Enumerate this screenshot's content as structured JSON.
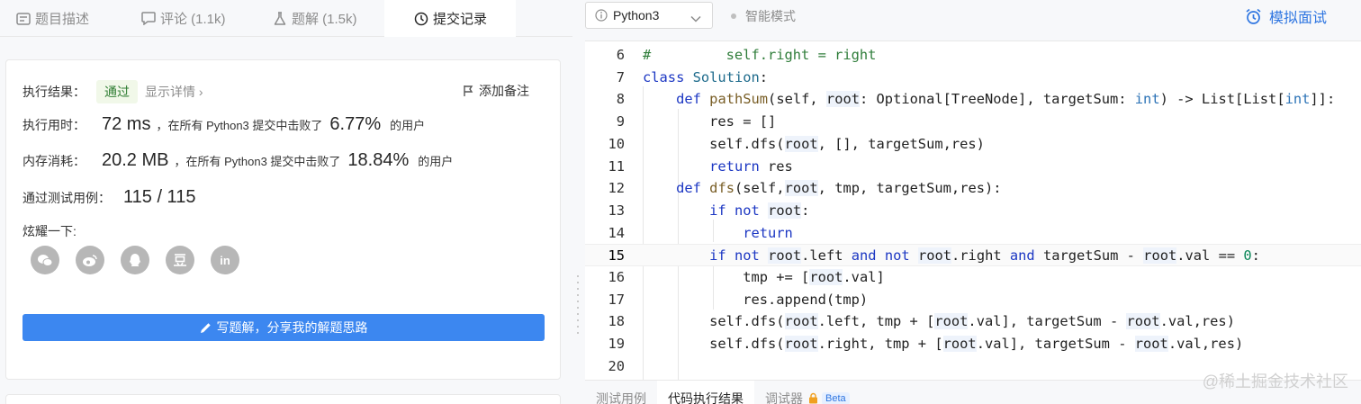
{
  "left_tabs": [
    {
      "label": "题目描述",
      "icon": "description-icon"
    },
    {
      "label": "评论 (1.1k)",
      "icon": "comment-icon"
    },
    {
      "label": "题解 (1.5k)",
      "icon": "flask-icon"
    },
    {
      "label": "提交记录",
      "icon": "clock-icon"
    }
  ],
  "result": {
    "label": "执行结果：",
    "status": "通过",
    "detail_link": "显示详情 ›",
    "add_note": "添加备注",
    "runtime_label": "执行用时：",
    "runtime_value": "72 ms",
    "runtime_text": "，在所有 Python3 提交中击败了",
    "runtime_pct": "6.77%",
    "users_suffix": "的用户",
    "memory_label": "内存消耗：",
    "memory_value": "20.2 MB",
    "memory_text": "，在所有 Python3 提交中击败了",
    "memory_pct": "18.84%",
    "tests_label": "通过测试用例：",
    "tests_value": "115 / 115",
    "share_label": "炫耀一下:",
    "write_button": "写题解，分享我的解题思路"
  },
  "social_icons": [
    "wechat-icon",
    "weibo-icon",
    "qq-icon",
    "douban-icon",
    "linkedin-icon"
  ],
  "toolbar": {
    "language": "Python3",
    "smart_mode": "智能模式",
    "mock_interview": "模拟面试"
  },
  "code_lines": [
    {
      "n": "6",
      "text": "#         self.right = right"
    },
    {
      "n": "7",
      "text": "class Solution:"
    },
    {
      "n": "8",
      "text": "    def pathSum(self, root: Optional[TreeNode], targetSum: int) -> List[List[int]]:"
    },
    {
      "n": "9",
      "text": "        res = []"
    },
    {
      "n": "10",
      "text": "        self.dfs(root, [], targetSum,res)"
    },
    {
      "n": "11",
      "text": "        return res"
    },
    {
      "n": "12",
      "text": "    def dfs(self,root, tmp, targetSum,res):"
    },
    {
      "n": "13",
      "text": "        if not root:"
    },
    {
      "n": "14",
      "text": "            return"
    },
    {
      "n": "15",
      "text": "        if not root.left and not root.right and targetSum - root.val == 0:"
    },
    {
      "n": "16",
      "text": "            tmp += [root.val]"
    },
    {
      "n": "17",
      "text": "            res.append(tmp)"
    },
    {
      "n": "18",
      "text": "        self.dfs(root.left, tmp + [root.val], targetSum - root.val,res)"
    },
    {
      "n": "19",
      "text": "        self.dfs(root.right, tmp + [root.val], targetSum - root.val,res)"
    },
    {
      "n": "20",
      "text": ""
    }
  ],
  "bottom_tabs": [
    "测试用例",
    "代码执行结果",
    "调试器"
  ],
  "beta_label": "Beta",
  "watermark": "@稀土掘金技术社区",
  "colors": {
    "accent": "#3c87f0",
    "pass_green": "#2e7d32",
    "keyword": "#1c37c3"
  }
}
